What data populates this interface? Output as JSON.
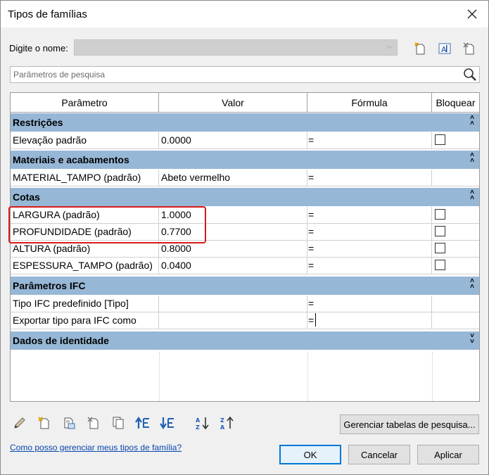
{
  "window": {
    "title": "Tipos de famílias"
  },
  "type_name": {
    "label": "Digite o nome:",
    "value": ""
  },
  "search": {
    "placeholder": "Parâmetros de pesquisa"
  },
  "table": {
    "headers": [
      "Parâmetro",
      "Valor",
      "Fórmula",
      "Bloquear"
    ],
    "groups": [
      {
        "name": "Restrições",
        "rows": [
          {
            "param": "Elevação padrão",
            "value": "0.0000",
            "formula": "=",
            "lock": true
          }
        ]
      },
      {
        "name": "Materiais e acabamentos",
        "rows": [
          {
            "param": "MATERIAL_TAMPO (padrão)",
            "value": "Abeto vermelho",
            "formula": "=",
            "lock": false
          }
        ]
      },
      {
        "name": "Cotas",
        "rows": [
          {
            "param": "LARGURA (padrão)",
            "value": "1.0000",
            "formula": "=",
            "lock": true
          },
          {
            "param": "PROFUNDIDADE (padrão)",
            "value": "0.7700",
            "formula": "=",
            "lock": true
          },
          {
            "param": "ALTURA (padrão)",
            "value": "0.8000",
            "formula": "=",
            "lock": true
          },
          {
            "param": "ESPESSURA_TAMPO (padrão)",
            "value": "0.0400",
            "formula": "=",
            "lock": true
          }
        ]
      },
      {
        "name": "Parâmetros IFC",
        "rows": [
          {
            "param": "Tipo IFC predefinido [Tipo]",
            "value": "",
            "formula": "=",
            "lock": false
          },
          {
            "param": "Exportar tipo para IFC como",
            "value": "",
            "formula": "=",
            "lock": false
          }
        ]
      },
      {
        "name": "Dados de identidade",
        "rows": []
      }
    ]
  },
  "buttons": {
    "manage_lookup": "Gerenciar tabelas de pesquisa...",
    "ok": "OK",
    "cancel": "Cancelar",
    "apply": "Aplicar"
  },
  "help_link": "Como posso gerenciar meus tipos de família?",
  "colors": {
    "group_header": "#97b7d6",
    "highlight": "#d81a1a",
    "link": "#0645ad"
  }
}
